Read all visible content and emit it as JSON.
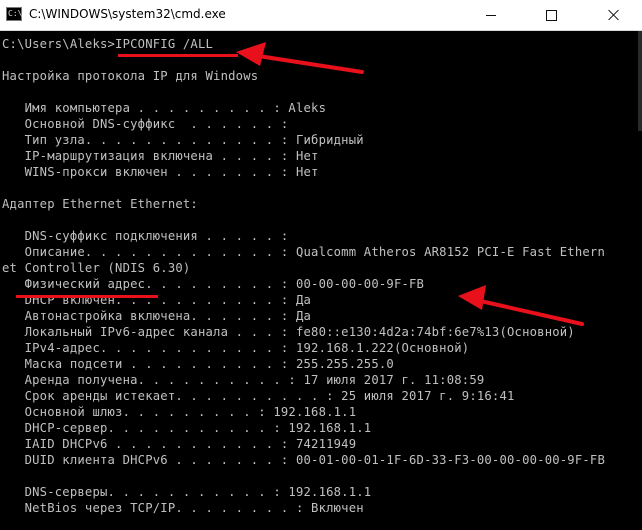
{
  "window": {
    "title": "C:\\WINDOWS\\system32\\cmd.exe",
    "icon_name": "cmd-icon",
    "icon_glyph": "C:\\"
  },
  "console": {
    "lines": [
      "C:\\Users\\Aleks>IPCONFIG /ALL",
      "",
      "Настройка протокола IP для Windows",
      "",
      "   Имя компьютера . . . . . . . . . : Aleks",
      "   Основной DNS-суффикс  . . . . . . :",
      "   Тип узла. . . . . . . . . . . . . : Гибридный",
      "   IP-маршрутизация включена . . . . : Нет",
      "   WINS-прокси включен . . . . . . . : Нет",
      "",
      "Адаптер Ethernet Ethernet:",
      "",
      "   DNS-суффикс подключения . . . . . :",
      "   Описание. . . . . . . . . . . . . : Qualcomm Atheros AR8152 PCI-E Fast Ethern",
      "et Controller (NDIS 6.30)",
      "   Физический адрес. . . . . . . . . : 00-00-00-00-9F-FB",
      "   DHCP включен. . . . . . . . . . . : Да",
      "   Автонастройка включена. . . . . . : Да",
      "   Локальный IPv6-адрес канала . . . : fe80::e130:4d2a:74bf:6e7%13(Основной)",
      "   IPv4-адрес. . . . . . . . . . . . : 192.168.1.222(Основной)",
      "   Маска подсети . . . . . . . . . . : 255.255.255.0",
      "   Аренда получена. . . . . . . . . . : 17 июля 2017 г. 11:08:59",
      "   Срок аренды истекает. . . . . . . . . . : 25 июля 2017 г. 9:16:41",
      "   Основной шлюз. . . . . . . . . : 192.168.1.1",
      "   DHCP-сервер. . . . . . . . . . . : 192.168.1.1",
      "   IAID DHCPv6 . . . . . . . . . . . : 74211949",
      "   DUID клиента DHCPv6 . . . . . . . : 00-01-00-01-1F-6D-33-F3-00-00-00-00-9F-FB",
      "",
      "   DNS-серверы. . . . . . . . . . . : 192.168.1.1",
      "   NetBios через TCP/IP. . . . . . . . : Включен"
    ]
  },
  "annotations": {
    "color": "#e8101a"
  }
}
